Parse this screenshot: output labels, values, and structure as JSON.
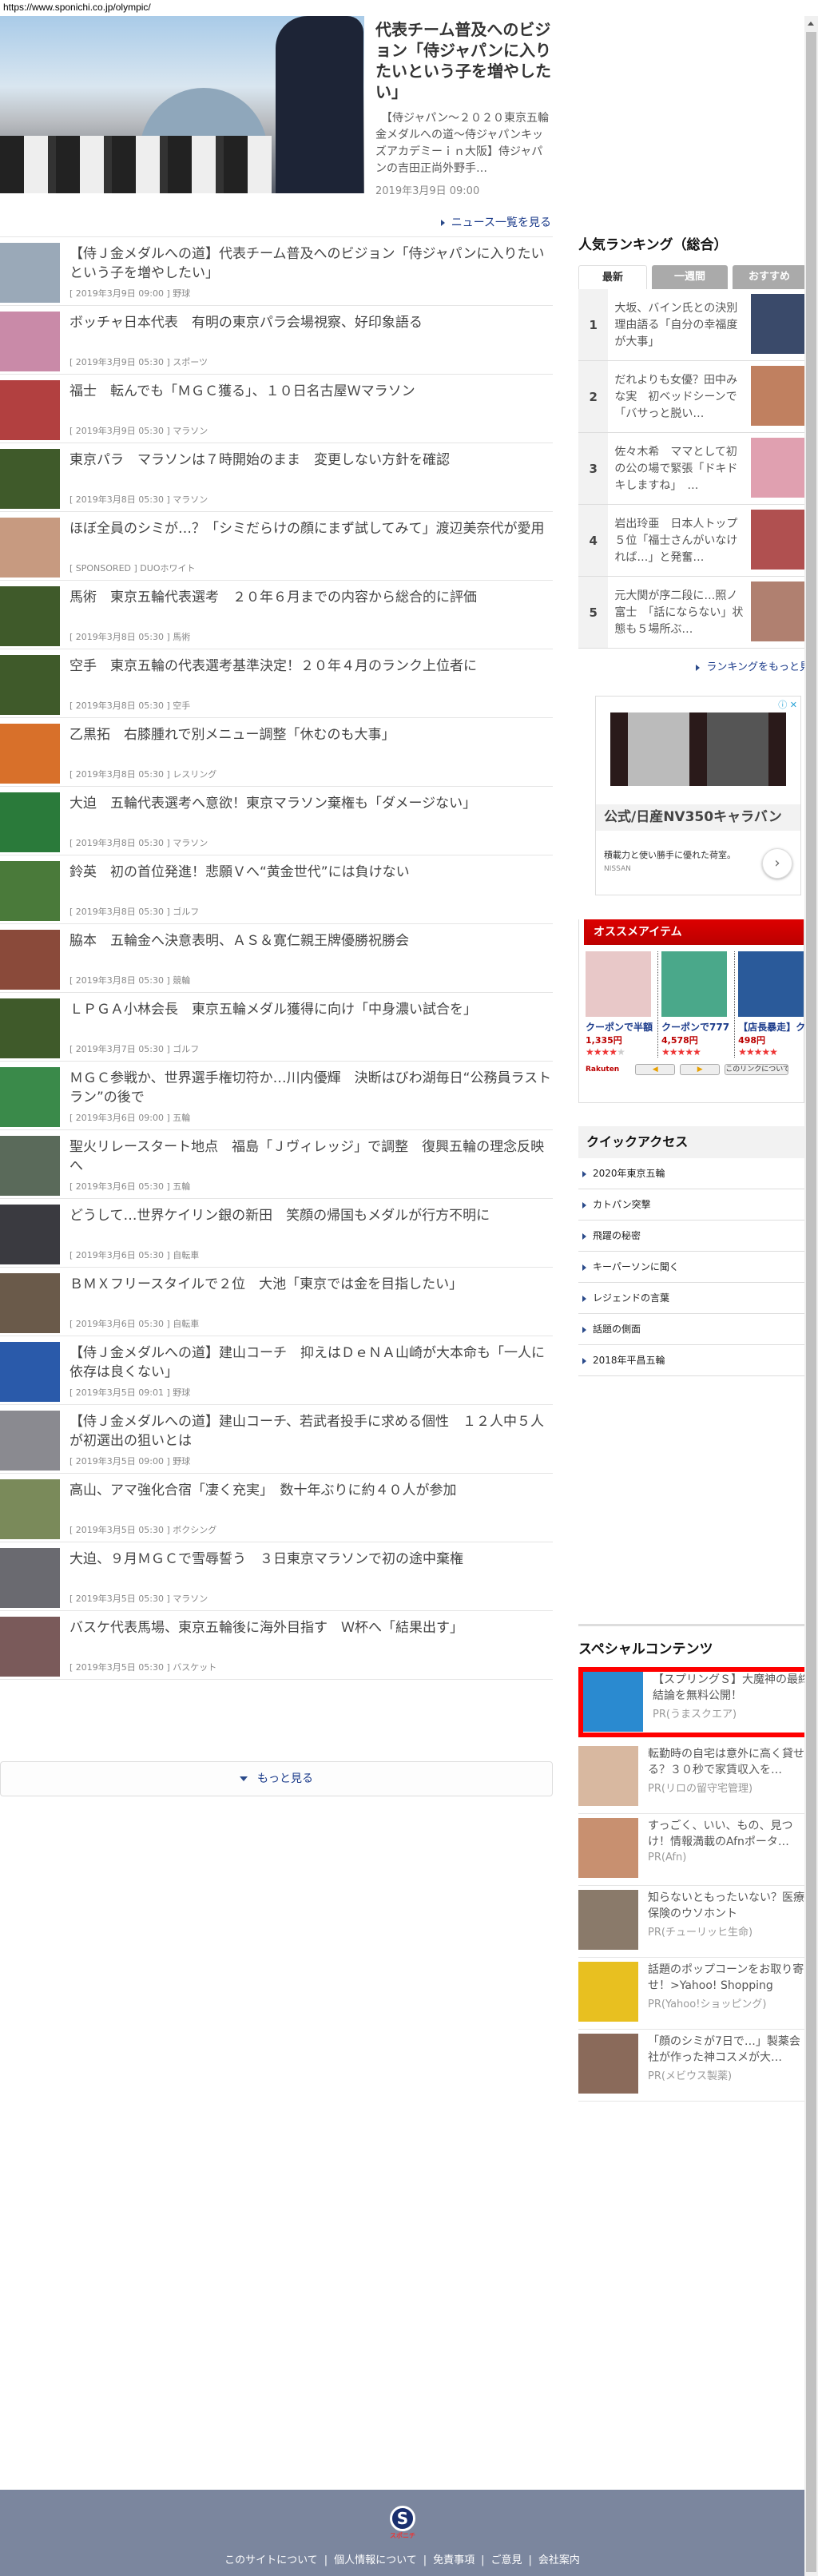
{
  "browser": {
    "url": "https://www.sponichi.co.jp/olympic/"
  },
  "hero": {
    "title": "代表チーム普及へのビジョン「侍ジャパンに入りたいという子を増やしたい」",
    "summary": "　【侍ジャパン～２０２０東京五輪金メダルへの道～侍ジャパンキッズアカデミーｉｎ大阪】侍ジャパンの吉田正尚外野手…",
    "date": "2019年3月9日 09:00",
    "more_label": "ニュース一覧を見る"
  },
  "news": [
    {
      "title": "【侍Ｊ金メダルへの道】代表チーム普及へのビジョン「侍ジャパンに入りたいという子を増やしたい」",
      "date": "[ 2019年3月9日 09:00 ]",
      "category": "野球",
      "thumb_color": "#9aa9b8"
    },
    {
      "title": "ボッチャ日本代表　有明の東京パラ会場視察、好印象語る",
      "date": "[ 2019年3月9日 05:30 ]",
      "category": "スポーツ",
      "thumb_color": "#c98aa8"
    },
    {
      "title": "福士　転んでも「ＭＧＣ獲る」、１０日名古屋Ｗマラソン",
      "date": "[ 2019年3月9日 05:30 ]",
      "category": "マラソン",
      "thumb_color": "#b24040"
    },
    {
      "title": "東京パラ　マラソンは７時開始のまま　変更しない方針を確認",
      "date": "[ 2019年3月8日 05:30 ]",
      "category": "マラソン",
      "thumb_color": "#3f5a2a"
    },
    {
      "title": "ほぼ全員のシミが…？「シミだらけの顔にまず試してみて」渡辺美奈代が愛用",
      "date": "[ SPONSORED ]",
      "category": "DUOホワイト",
      "thumb_color": "#c79a80"
    },
    {
      "title": "馬術　東京五輪代表選考　２０年６月までの内容から総合的に評価",
      "date": "[ 2019年3月8日 05:30 ]",
      "category": "馬術",
      "thumb_color": "#3f5a2a"
    },
    {
      "title": "空手　東京五輪の代表選考基準決定！２０年４月のランク上位者に",
      "date": "[ 2019年3月8日 05:30 ]",
      "category": "空手",
      "thumb_color": "#3f5a2a"
    },
    {
      "title": "乙黒拓　右膝腫れで別メニュー調整「休むのも大事」",
      "date": "[ 2019年3月8日 05:30 ]",
      "category": "レスリング",
      "thumb_color": "#d8702a"
    },
    {
      "title": "大迫　五輪代表選考へ意欲！東京マラソン棄権も「ダメージない」",
      "date": "[ 2019年3月8日 05:30 ]",
      "category": "マラソン",
      "thumb_color": "#2a7a3a"
    },
    {
      "title": "鈴英　初の首位発進！悲願Ｖへ“黄金世代”には負けない",
      "date": "[ 2019年3月8日 05:30 ]",
      "category": "ゴルフ",
      "thumb_color": "#4a7a3a"
    },
    {
      "title": "脇本　五輪金へ決意表明、ＡＳ＆寛仁親王牌優勝祝勝会",
      "date": "[ 2019年3月8日 05:30 ]",
      "category": "競輪",
      "thumb_color": "#8a4a3a"
    },
    {
      "title": "ＬＰＧＡ小林会長　東京五輪メダル獲得に向け「中身濃い試合を」",
      "date": "[ 2019年3月7日 05:30 ]",
      "category": "ゴルフ",
      "thumb_color": "#3f5a2a"
    },
    {
      "title": "ＭＧＣ参戦か、世界選手権切符か…川内優輝　決断はびわ湖毎日“公務員ラストラン”の後で",
      "date": "[ 2019年3月6日 09:00 ]",
      "category": "五輪",
      "thumb_color": "#3a8a4a"
    },
    {
      "title": "聖火リレースタート地点　福島「Ｊヴィレッジ」で調整　復興五輪の理念反映へ",
      "date": "[ 2019年3月6日 05:30 ]",
      "category": "五輪",
      "thumb_color": "#5a6a5a"
    },
    {
      "title": "どうして…世界ケイリン銀の新田　笑顔の帰国もメダルが行方不明に",
      "date": "[ 2019年3月6日 05:30 ]",
      "category": "自転車",
      "thumb_color": "#3a3a40"
    },
    {
      "title": "ＢＭＸフリースタイルで２位　大池「東京では金を目指したい」",
      "date": "[ 2019年3月6日 05:30 ]",
      "category": "自転車",
      "thumb_color": "#6a5a4a"
    },
    {
      "title": "【侍Ｊ金メダルへの道】建山コーチ　抑えはＤｅＮＡ山崎が大本命も「一人に依存は良くない」",
      "date": "[ 2019年3月5日 09:01 ]",
      "category": "野球",
      "thumb_color": "#2a5aaa"
    },
    {
      "title": "【侍Ｊ金メダルへの道】建山コーチ、若武者投手に求める個性　１２人中５人が初選出の狙いとは",
      "date": "[ 2019年3月5日 09:00 ]",
      "category": "野球",
      "thumb_color": "#8a8a90"
    },
    {
      "title": "高山、アマ強化合宿「凄く充実」　数十年ぶりに約４０人が参加",
      "date": "[ 2019年3月5日 05:30 ]",
      "category": "ボクシング",
      "thumb_color": "#7a8a5a"
    },
    {
      "title": "大迫、９月ＭＧＣで雪辱誓う　３日東京マラソンで初の途中棄権",
      "date": "[ 2019年3月5日 05:30 ]",
      "category": "マラソン",
      "thumb_color": "#6a6a70"
    },
    {
      "title": "バスケ代表馬場、東京五輪後に海外目指す　Ｗ杯へ「結果出す」",
      "date": "[ 2019年3月5日 05:30 ]",
      "category": "バスケット",
      "thumb_color": "#7a5a5a"
    }
  ],
  "more_button": "もっと見る",
  "ranking": {
    "title": "人気ランキング（総合）",
    "tabs": [
      "最新",
      "一週間",
      "おすすめ"
    ],
    "items": [
      {
        "rank": "1",
        "title": "大坂、バイン氏との決別理由語る「自分の幸福度が大事」",
        "thumb_color": "#3a4a6a"
      },
      {
        "rank": "2",
        "title": "だれよりも女優？田中みな実　初ベッドシーンで「バサっと脱い…",
        "thumb_color": "#c08060"
      },
      {
        "rank": "3",
        "title": "佐々木希　ママとして初の公の場で緊張「ドキドキしますね」　…",
        "thumb_color": "#e0a0b0"
      },
      {
        "rank": "4",
        "title": "岩出玲亜　日本人トップ５位「福士さんがいなければ…」と発奮…",
        "thumb_color": "#b05050"
      },
      {
        "rank": "5",
        "title": "元大関が序二段に…照ノ富士　「話にならない」状態も５場所ぶ…",
        "thumb_color": "#b08070"
      }
    ],
    "more_label": "ランキングをもっと見る"
  },
  "ad": {
    "title": "公式/日産NV350キャラバン",
    "description": "積載力と使い勝手に優れた荷室。",
    "brand": "NISSAN",
    "icons": "ⓘ ✕"
  },
  "recommended": {
    "title": "オススメアイテム",
    "items": [
      {
        "name": "クーポンで半額",
        "price": "1,335円",
        "rating": 4,
        "thumb_color": "#e8c8c8"
      },
      {
        "name": "クーポンで777",
        "price": "4,578円",
        "rating": 4.5,
        "thumb_color": "#4aa88a"
      },
      {
        "name": "【店長暴走】クー",
        "price": "498円",
        "rating": 4.5,
        "thumb_color": "#2a5a9a"
      }
    ],
    "brand": "Rakuten",
    "prev": "◀",
    "next": "▶",
    "about": "このリンクについて"
  },
  "quick_access": {
    "title": "クイックアクセス",
    "items": [
      "2020年東京五輪",
      "カトパン突撃",
      "飛躍の秘密",
      "キーパーソンに聞く",
      "レジェンドの言葉",
      "話題の側面",
      "2018年平昌五輪"
    ]
  },
  "special": {
    "title": "スペシャルコンテンツ",
    "items": [
      {
        "title": "【スプリングＳ】大魔神の最終結論を無料公開！",
        "pr": "PR(うまスクエア)",
        "thumb_color": "#2a8ad0"
      },
      {
        "title": "転勤時の自宅は意外に高く貸せる？３０秒で家賃収入を…",
        "pr": "PR(リロの留守宅管理)",
        "thumb_color": "#d8b8a0"
      },
      {
        "title": "すっごく、いい、もの、見つけ！情報満載のAfnポータ…",
        "pr": "PR(Afn)",
        "thumb_color": "#c89070"
      },
      {
        "title": "知らないともったいない？医療保険のウソホント",
        "pr": "PR(チューリッヒ生命)",
        "thumb_color": "#8a7a6a"
      },
      {
        "title": "話題のポップコーンをお取り寄せ！>Yahoo! Shopping",
        "pr": "PR(Yahoo!ショッピング)",
        "thumb_color": "#e8c020"
      },
      {
        "title": "「顔のシミが7日で…」製薬会社が作った神コスメが大…",
        "pr": "PR(メビウス製薬)",
        "thumb_color": "#8a6a5a"
      }
    ]
  },
  "footer": {
    "logo_text": "スポニチ",
    "links": [
      "このサイトについて",
      "個人情報について",
      "免責事項",
      "ご意見",
      "会社案内"
    ]
  }
}
